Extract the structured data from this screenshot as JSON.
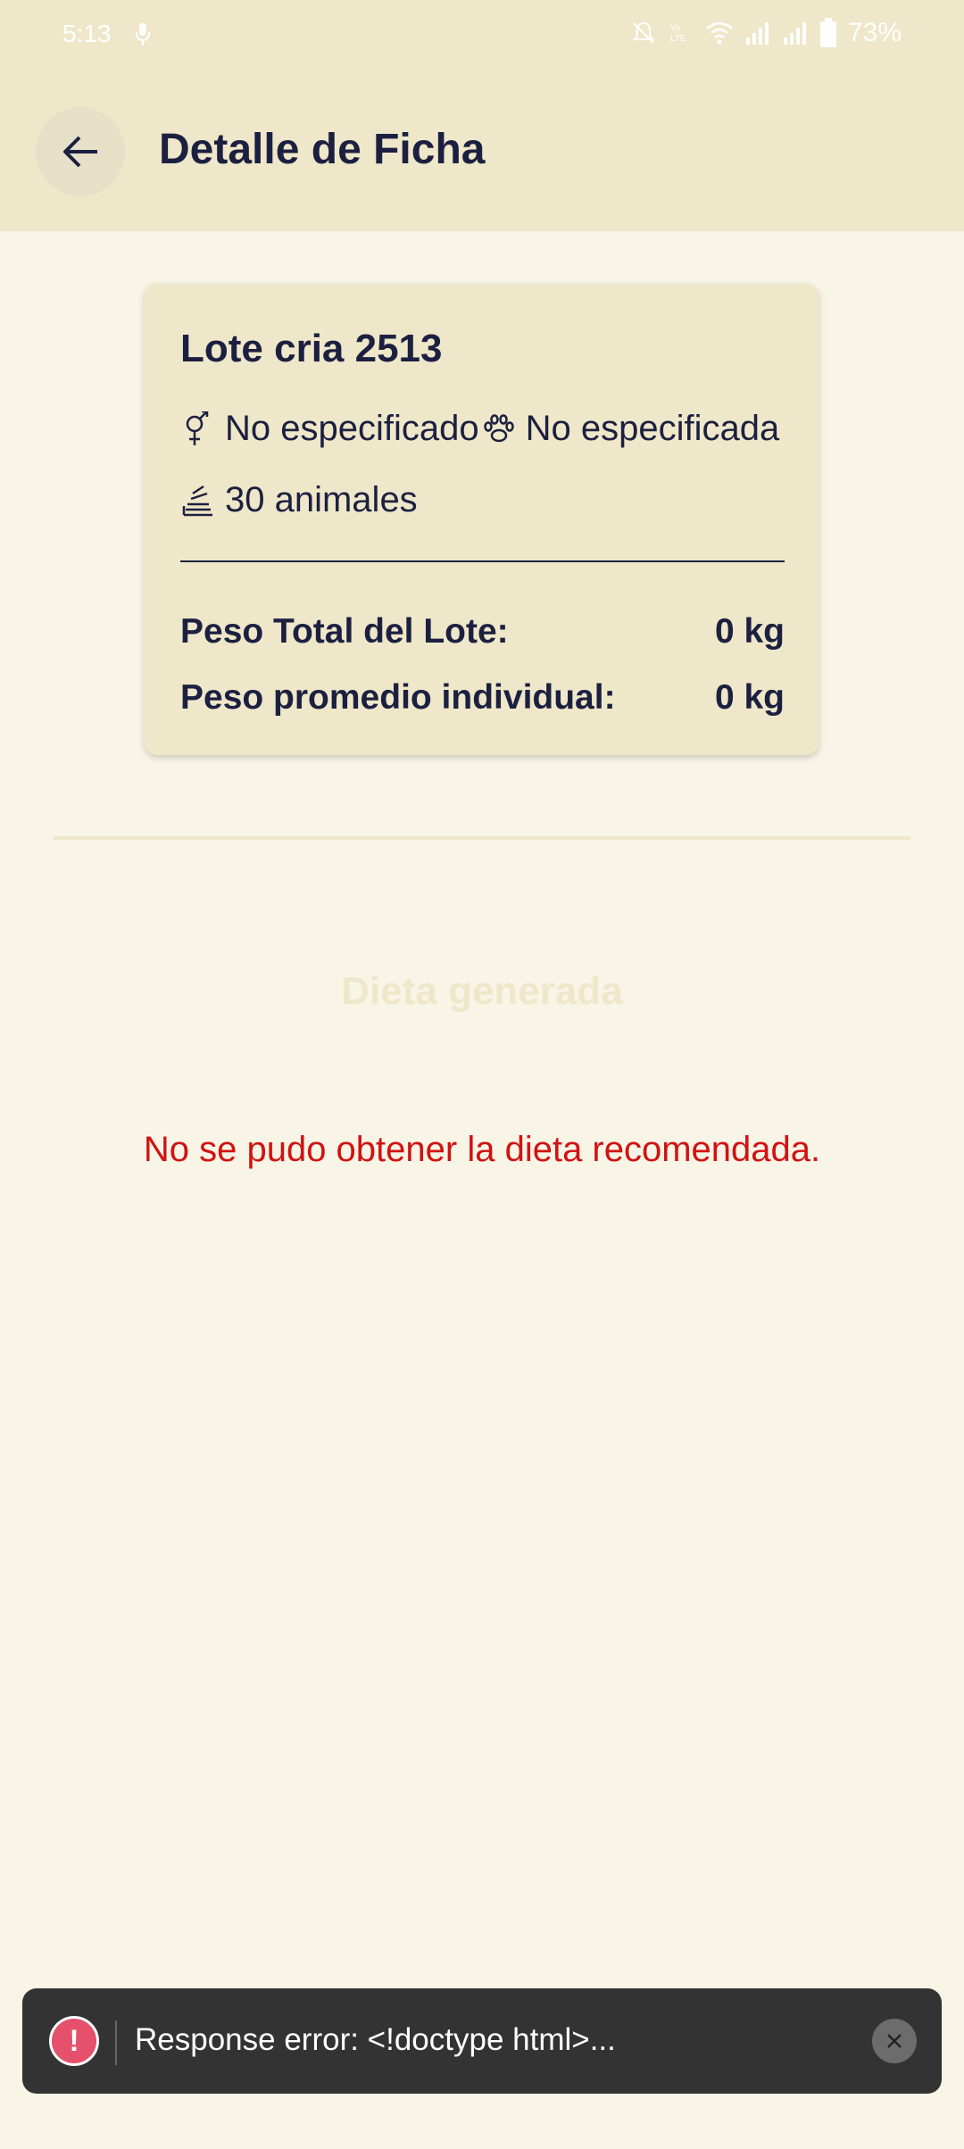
{
  "status_bar": {
    "time": "5:13",
    "battery": "73%",
    "icons": [
      "mic-icon",
      "mute-icon",
      "volte-icon",
      "wifi-icon",
      "signal-icon",
      "signal-icon",
      "battery-icon"
    ]
  },
  "app_bar": {
    "title": "Detalle de Ficha",
    "back_icon": "arrow-left-icon"
  },
  "card": {
    "title": "Lote cria 2513",
    "sex": "No especificado",
    "species": "No especificada",
    "animals": "30 animales",
    "total_weight_label": "Peso Total del Lote:",
    "total_weight_value": "0 kg",
    "avg_weight_label": "Peso promedio individual:",
    "avg_weight_value": "0 kg"
  },
  "diet": {
    "heading": "Dieta generada",
    "error": "No se pudo obtener la dieta recomendada."
  },
  "toast": {
    "message": "Response error: <!doctype html>...",
    "alert_icon": "!"
  },
  "colors": {
    "header_bg": "#efe7c9",
    "page_bg": "#f8f4e6",
    "text_dark": "#1c2040",
    "error_red": "#d11212",
    "toast_bg": "#333333",
    "alert_pink": "#e5506a"
  }
}
